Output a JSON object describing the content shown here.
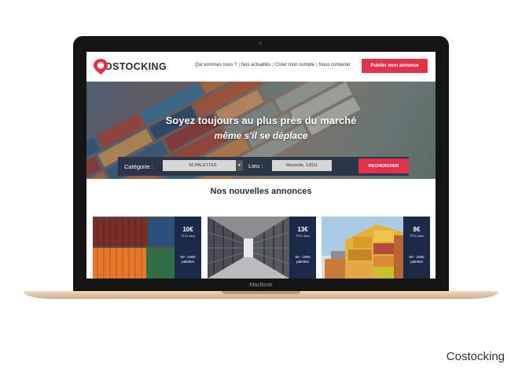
{
  "device": {
    "label": "MacBook"
  },
  "caption": "Costocking",
  "site": {
    "logo_text": "OSTOCKING",
    "nav": [
      "Qui sommes nous ?",
      "Nos actualités",
      "Créer mon compte",
      "Nous contacter"
    ],
    "nav_separator": "|",
    "publish_label": "Publier mon annonce",
    "accent_color": "#e5304a",
    "navy_color": "#1c2a4a"
  },
  "hero": {
    "title": "Soyez toujours au plus près du marché",
    "subtitle": "même s'il se déplace"
  },
  "search": {
    "category_label": "Catégorie :",
    "category_value": "50 PALETTES",
    "location_label": "Lieu :",
    "location_value": "Marseille, 13011",
    "button_label": "RECHERCHER"
  },
  "listings": {
    "title": "Nos nouvelles annonces",
    "cards": [
      {
        "price": "10€",
        "unit": "TTC/ Jour",
        "range": "50 - 1000",
        "range_unit": "palettes"
      },
      {
        "price": "13€",
        "unit": "TTC/ Jour",
        "range": "50 - 1000",
        "range_unit": "palettes"
      },
      {
        "price": "8€",
        "unit": "TTC/ Jour",
        "range": "50 - 1000",
        "range_unit": "palettes"
      }
    ]
  }
}
